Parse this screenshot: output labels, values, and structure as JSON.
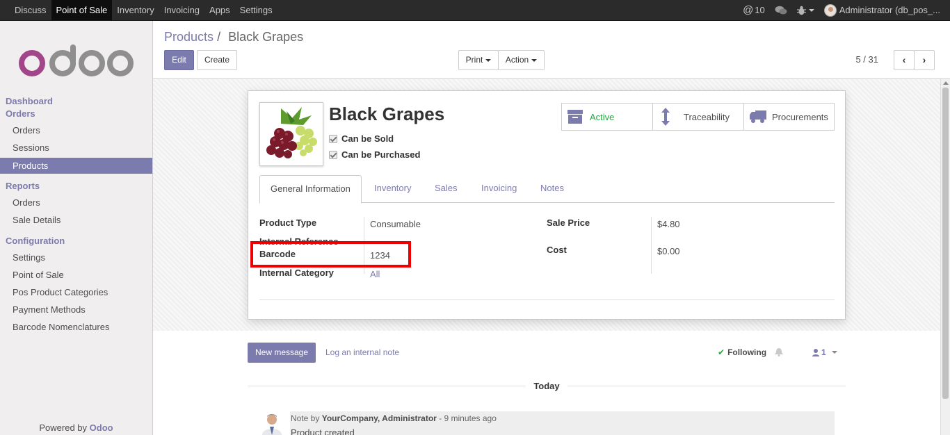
{
  "topbar": {
    "menu": [
      "Discuss",
      "Point of Sale",
      "Inventory",
      "Invoicing",
      "Apps",
      "Settings"
    ],
    "active_index": 1,
    "messages_count": "10",
    "user_label": "Administrator (db_pos_..."
  },
  "sidebar": {
    "logo_text": "odoo",
    "dashboard": "Dashboard",
    "orders_head": "Orders",
    "orders_items": [
      "Orders",
      "Sessions",
      "Products"
    ],
    "reports_head": "Reports",
    "reports_items": [
      "Orders",
      "Sale Details"
    ],
    "config_head": "Configuration",
    "config_items": [
      "Settings",
      "Point of Sale",
      "Pos Product Categories",
      "Payment Methods",
      "Barcode Nomenclatures"
    ],
    "powered_prefix": "Powered by",
    "powered_brand": "Odoo"
  },
  "control": {
    "breadcrumb_parent": "Products",
    "breadcrumb_sep": "/",
    "breadcrumb_current": "Black Grapes",
    "edit_label": "Edit",
    "create_label": "Create",
    "print_label": "Print",
    "action_label": "Action",
    "pager": "5 / 31"
  },
  "form": {
    "title": "Black Grapes",
    "can_be_sold": "Can be Sold",
    "can_be_purchased": "Can be Purchased",
    "smart_buttons": {
      "active": "Active",
      "traceability": "Traceability",
      "procurements": "Procurements"
    },
    "tabs": [
      "General Information",
      "Inventory",
      "Sales",
      "Invoicing",
      "Notes"
    ],
    "fields": {
      "product_type_label": "Product Type",
      "product_type_value": "Consumable",
      "internal_reference_label": "Internal Reference",
      "barcode_label": "Barcode",
      "barcode_value": "1234",
      "internal_category_label": "Internal Category",
      "internal_category_value": "All",
      "sale_price_label": "Sale Price",
      "sale_price_value": "$4.80",
      "cost_label": "Cost",
      "cost_value": "$0.00"
    }
  },
  "chatter": {
    "new_message": "New message",
    "log_note": "Log an internal note",
    "following": "Following",
    "followers_count": "1",
    "today": "Today",
    "message": {
      "prefix": "Note by",
      "author": "YourCompany, Administrator",
      "time": "- 9 minutes ago",
      "body": "Product created"
    }
  },
  "colors": {
    "brand": "#7c7bad",
    "active_green": "#28a745",
    "highlight": "#ee0000"
  }
}
